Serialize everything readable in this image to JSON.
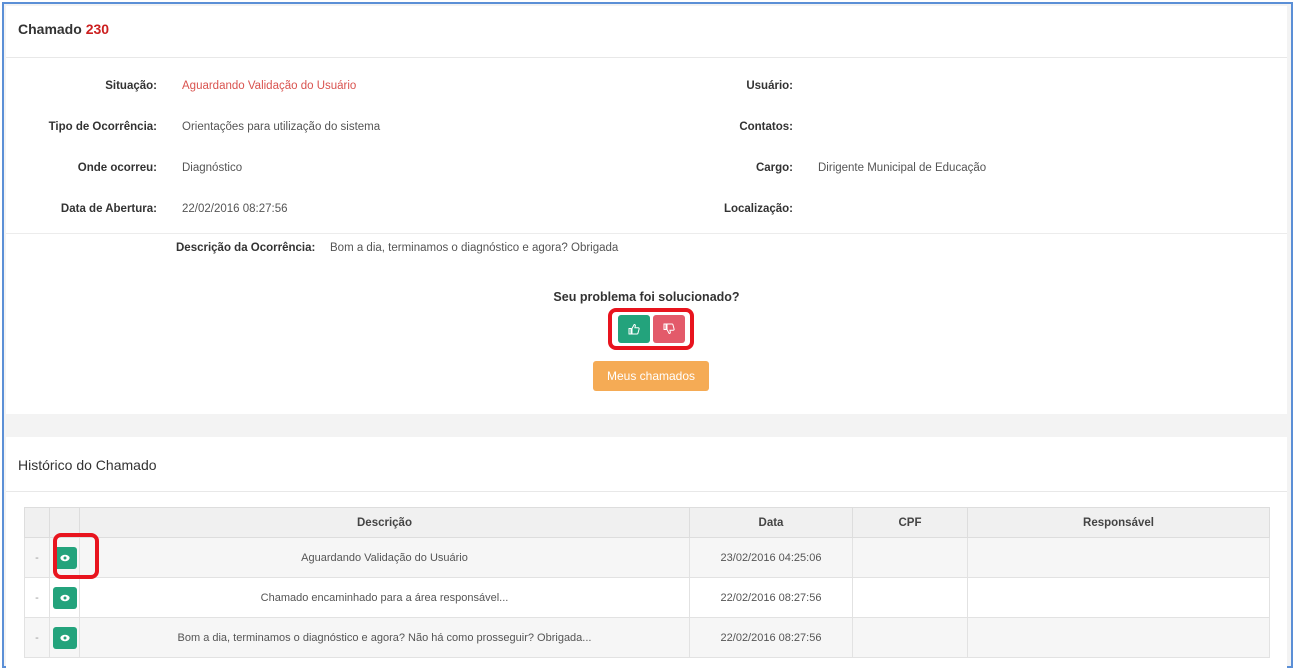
{
  "header": {
    "title_prefix": "Chamado",
    "ticket_number": "230"
  },
  "details": {
    "situacao_label": "Situação:",
    "situacao_value": "Aguardando Validação do Usuário",
    "tipo_label": "Tipo de Ocorrência:",
    "tipo_value": "Orientações para utilização do sistema",
    "onde_label": "Onde ocorreu:",
    "onde_value": "Diagnóstico",
    "data_label": "Data de Abertura:",
    "data_value": "22/02/2016 08:27:56",
    "usuario_label": "Usuário:",
    "contatos_label": "Contatos:",
    "cargo_label": "Cargo:",
    "cargo_value": "Dirigente Municipal de Educação",
    "localizacao_label": "Localização:",
    "descricao_label": "Descrição da Ocorrência:",
    "descricao_value": "Bom a dia, terminamos o diagnóstico e agora?  Obrigada"
  },
  "feedback": {
    "question": "Seu problema foi solucionado?",
    "yes_icon": "thumbs-up-icon",
    "no_icon": "thumbs-down-icon",
    "meus_chamados_label": "Meus chamados"
  },
  "history": {
    "title": "Histórico do Chamado",
    "columns": [
      "Descrição",
      "Data",
      "CPF",
      "Responsável"
    ],
    "rows": [
      {
        "dash": "-",
        "descricao": "Aguardando Validação do Usuário",
        "data": "23/02/2016 04:25:06",
        "cpf": "",
        "responsavel": ""
      },
      {
        "dash": "-",
        "descricao": "Chamado encaminhado para a área responsável...",
        "data": "22/02/2016 08:27:56",
        "cpf": "",
        "responsavel": ""
      },
      {
        "dash": "-",
        "descricao": "Bom a dia, terminamos o diagnóstico e agora? Não há como prosseguir? Obrigada...",
        "data": "22/02/2016 08:27:56",
        "cpf": "",
        "responsavel": ""
      }
    ]
  },
  "colors": {
    "accent_green": "#23a37c",
    "accent_red": "#e35a6a",
    "accent_orange": "#f5ab55",
    "status_red": "#d9534f",
    "highlight_red": "#e8141e"
  }
}
